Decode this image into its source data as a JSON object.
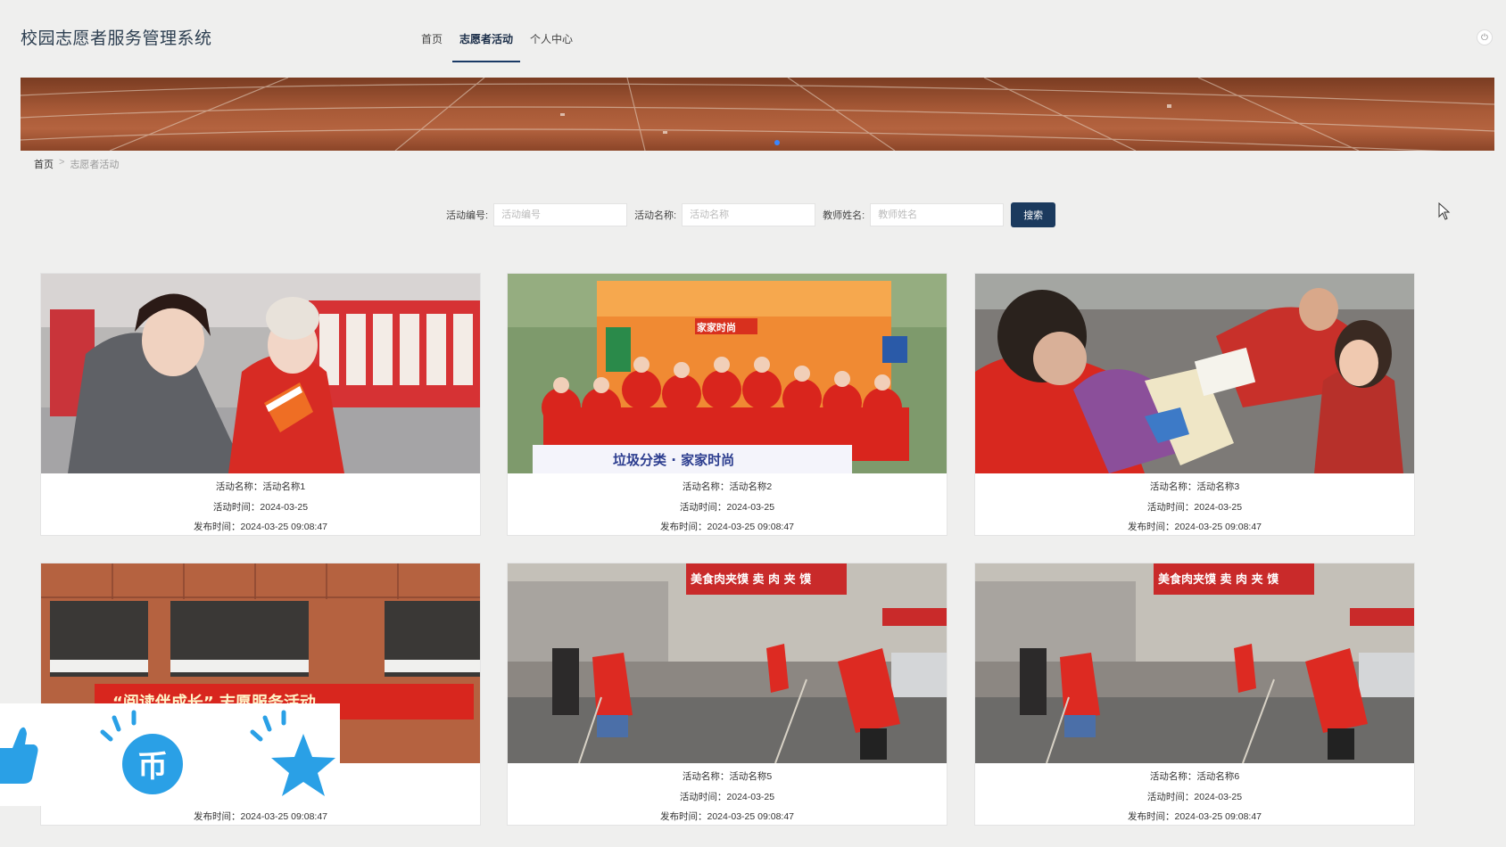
{
  "header": {
    "title": "校园志愿者服务管理系统",
    "nav": [
      "首页",
      "志愿者活动",
      "个人中心"
    ],
    "active_nav": 1
  },
  "breadcrumb": {
    "home": "首页",
    "sep": ">",
    "current": "志愿者活动"
  },
  "search": {
    "fields": [
      {
        "label": "活动编号:",
        "placeholder": "活动编号"
      },
      {
        "label": "活动名称:",
        "placeholder": "活动名称"
      },
      {
        "label": "教师姓名:",
        "placeholder": "教师姓名"
      }
    ],
    "button": "搜索"
  },
  "cards": [
    {
      "name": "活动名称：活动名称1",
      "date": "活动时间：2024-03-25",
      "publish": "发布时间：2024-03-25 09:08:47"
    },
    {
      "name": "活动名称：活动名称2",
      "date": "活动时间：2024-03-25",
      "publish": "发布时间：2024-03-25 09:08:47"
    },
    {
      "name": "活动名称：活动名称3",
      "date": "活动时间：2024-03-25",
      "publish": "发布时间：2024-03-25 09:08:47"
    },
    {
      "name": "",
      "date": "",
      "publish": "发布时间：2024-03-25 09:08:47",
      "banner_text": "“阅读伴成长” 志愿服务活动"
    },
    {
      "name": "活动名称：活动名称5",
      "date": "活动时间：2024-03-25",
      "publish": "发布时间：2024-03-25 09:08:47"
    },
    {
      "name": "活动名称：活动名称6",
      "date": "活动时间：2024-03-25",
      "publish": "发布时间：2024-03-25 09:08:47"
    }
  ],
  "photo_texts": {
    "card2_sign": "垃圾分类 · 家家时尚",
    "card2_banner": "家家时尚",
    "card5_shop": "美食肉夹馍 卖 肉 夹 馍"
  },
  "colors": {
    "primary": "#1b3a5e",
    "volunteer_red": "#d9251d",
    "accent_blue": "#2a9fe8"
  }
}
